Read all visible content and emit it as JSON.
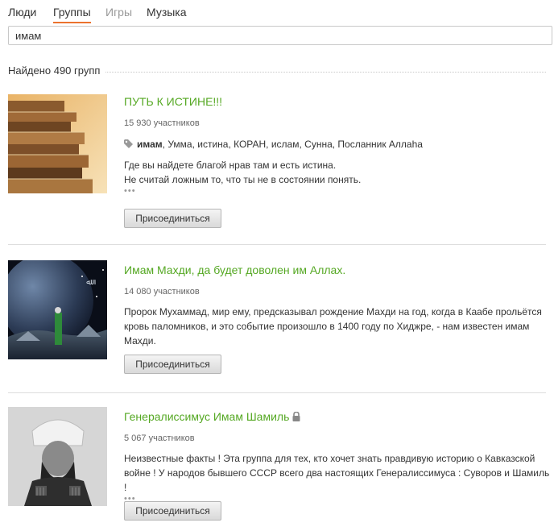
{
  "tabs": [
    {
      "label": "Люди"
    },
    {
      "label": "Группы"
    },
    {
      "label": "Игры"
    },
    {
      "label": "Музыка"
    }
  ],
  "search": {
    "value": "имам"
  },
  "results": {
    "found_text": "Найдено 490 групп"
  },
  "join_label": "Присоединиться",
  "dots": "•••",
  "groups": [
    {
      "title": "ПУТЬ К ИСТИНЕ!!!",
      "members": "15 930 участников",
      "tag_bold": "имам",
      "tags_rest": ", Умма, истина, КОРАН, ислам, Сунна, Посланник Аллаhа",
      "desc_line1": "Где вы найдете благой нрав там и есть истина.",
      "desc_line2": "Не считай ложным то, что ты не в состоянии понять.",
      "thumb_icon": "stacked-books-image"
    },
    {
      "title": "Имам Махди, да будет доволен им Аллах.",
      "members": "14 080 участников",
      "desc_line1": "Пророк Мухаммад, мир ему, предсказывал рождение Махди на год, когда в Каабе прольётся",
      "desc_line2": "кровь паломников, и это событие произошло в 1400 году по Хиджре, - нам известен имам",
      "desc_line3": "Махди.",
      "thumb_icon": "planet-figure-image"
    },
    {
      "title": "Генералиссимус Имам Шамиль",
      "members": "5 067 участников",
      "desc_line1": "Неизвестные факты ! Эта группа для тех, кто хочет знать правдивую историю о Кавказской",
      "desc_line2": "войне !  У народов бывшего СССР всего два настоящих Генералиссимуса : Суворов и Шамиль !",
      "thumb_icon": "portrait-image"
    }
  ]
}
